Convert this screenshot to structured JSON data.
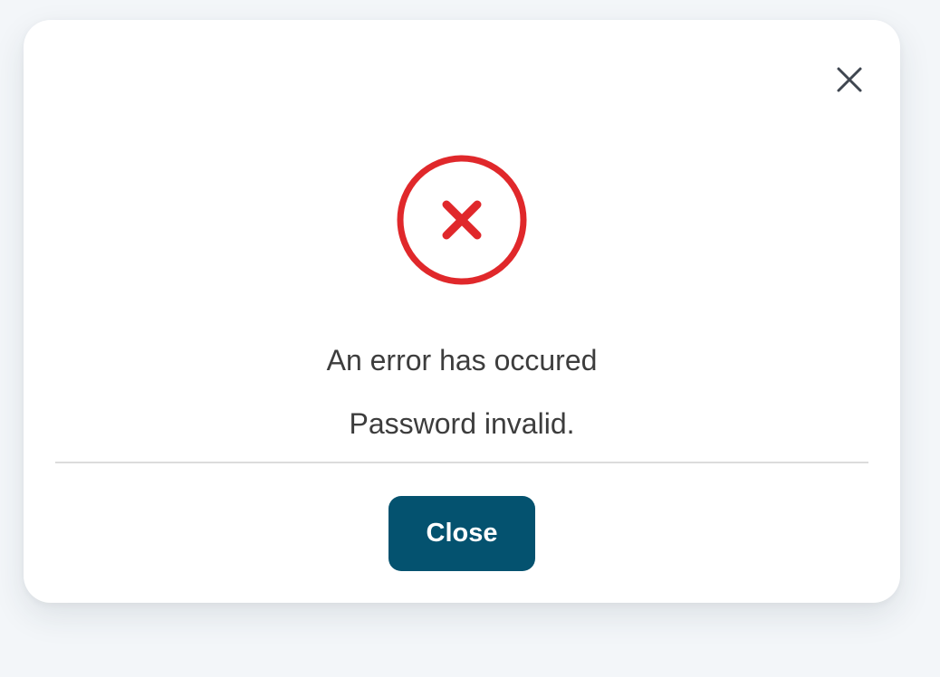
{
  "dialog": {
    "title": "An error has occured",
    "message": "Password invalid.",
    "close_button_label": "Close",
    "dismiss_icon": "close-icon",
    "status_icon": "error-circle-x-icon"
  },
  "colors": {
    "error": "#e0282b",
    "button": "#04526f",
    "text": "#3d3d3d",
    "dismiss_icon": "#3f4650",
    "background": "#f3f6f9",
    "card": "#ffffff",
    "divider": "#dcdcdc"
  }
}
